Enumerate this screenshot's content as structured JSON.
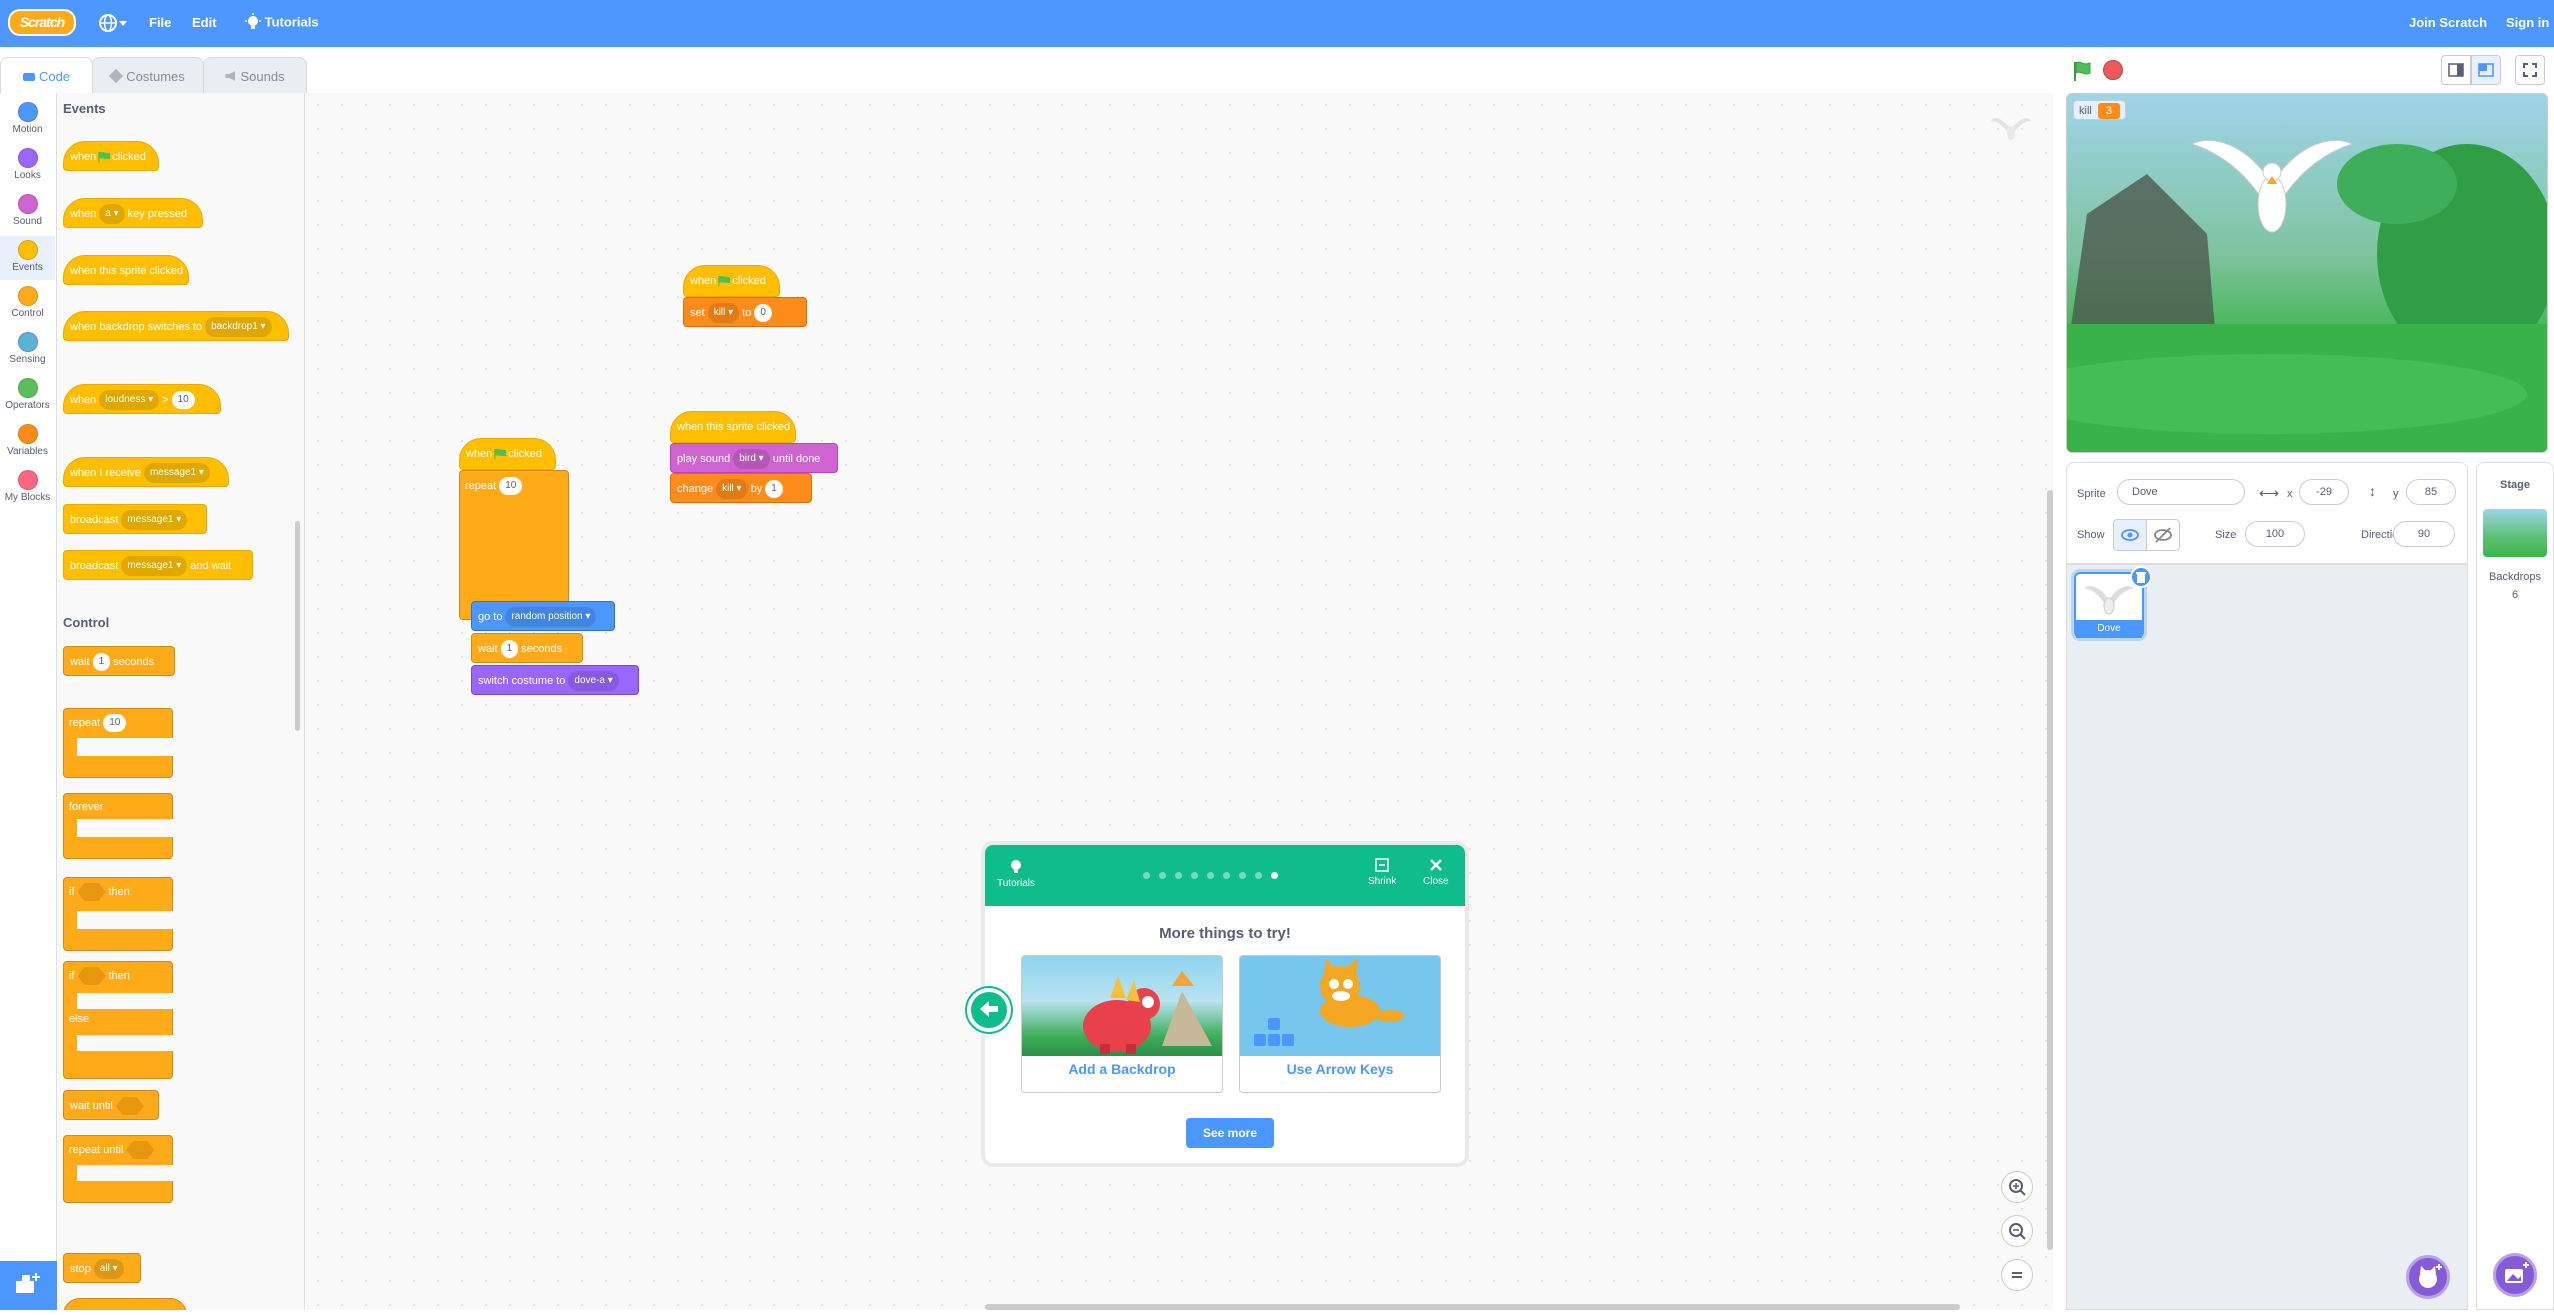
{
  "menubar": {
    "logo": "Scratch",
    "file": "File",
    "edit": "Edit",
    "tutorials": "Tutorials",
    "join": "Join Scratch",
    "signin": "Sign in"
  },
  "tabs": {
    "code": "Code",
    "costumes": "Costumes",
    "sounds": "Sounds"
  },
  "categories": [
    {
      "label": "Motion",
      "color": "#4c97ff"
    },
    {
      "label": "Looks",
      "color": "#9966ff"
    },
    {
      "label": "Sound",
      "color": "#cf63cf"
    },
    {
      "label": "Events",
      "color": "#ffbf00"
    },
    {
      "label": "Control",
      "color": "#ffab19"
    },
    {
      "label": "Sensing",
      "color": "#5cb1d6"
    },
    {
      "label": "Operators",
      "color": "#59c059"
    },
    {
      "label": "Variables",
      "color": "#ff8c1a"
    },
    {
      "label": "My Blocks",
      "color": "#ff6680"
    }
  ],
  "palette": {
    "events_title": "Events",
    "control_title": "Control",
    "when": "when",
    "clicked": "clicked",
    "key_pressed": "key pressed",
    "key_value": "a",
    "when_sprite_clicked": "when this sprite clicked",
    "when_backdrop": "when backdrop switches to",
    "backdrop_value": "backdrop1",
    "loudness": "loudness",
    "gt": ">",
    "loud_value": "10",
    "when_receive": "when I receive",
    "message": "message1",
    "broadcast": "broadcast",
    "and_wait": "and wait",
    "wait": "wait",
    "wait_value": "1",
    "seconds": "seconds",
    "repeat": "repeat",
    "repeat_value": "10",
    "forever": "forever",
    "if": "if",
    "then": "then",
    "else": "else",
    "wait_until": "wait until",
    "repeat_until": "repeat until",
    "stop": "stop",
    "stop_value": "all"
  },
  "scripts": {
    "s1_when": "when",
    "s1_clicked": "clicked",
    "s1_set": "set",
    "s1_var": "kill",
    "s1_to": "to",
    "s1_val": "0",
    "s2_hat": "when this sprite clicked",
    "s2_play": "play sound",
    "s2_sound": "bird",
    "s2_until": "until done",
    "s2_change": "change",
    "s2_var": "kill",
    "s2_by": "by",
    "s2_val": "1",
    "s3_when": "when",
    "s3_clicked": "clicked",
    "s3_repeat": "repeat",
    "s3_repeat_val": "10",
    "s3_goto": "go to",
    "s3_goto_val": "random position",
    "s3_wait": "wait",
    "s3_wait_val": "1",
    "s3_seconds": "seconds",
    "s3_switch": "switch costume to",
    "s3_costume": "dove-a"
  },
  "stage": {
    "monitor_label": "kill",
    "monitor_value": "3"
  },
  "sprite_info": {
    "sprite_label": "Sprite",
    "sprite_name": "Dove",
    "x_label": "x",
    "x_value": "-29",
    "y_label": "y",
    "y_value": "85",
    "show_label": "Show",
    "size_label": "Size",
    "size_value": "100",
    "direction_label": "Direction",
    "direction_value": "90"
  },
  "sprite_list": [
    {
      "name": "Dove"
    }
  ],
  "stage_panel": {
    "title": "Stage",
    "backdrops_label": "Backdrops",
    "backdrops_count": "6"
  },
  "tutorial": {
    "header_label": "Tutorials",
    "shrink": "Shrink",
    "close": "Close",
    "title": "More things to try!",
    "card1": "Add a Backdrop",
    "card2": "Use Arrow Keys",
    "see_more": "See more",
    "page_count": 9,
    "active_page": 9
  }
}
